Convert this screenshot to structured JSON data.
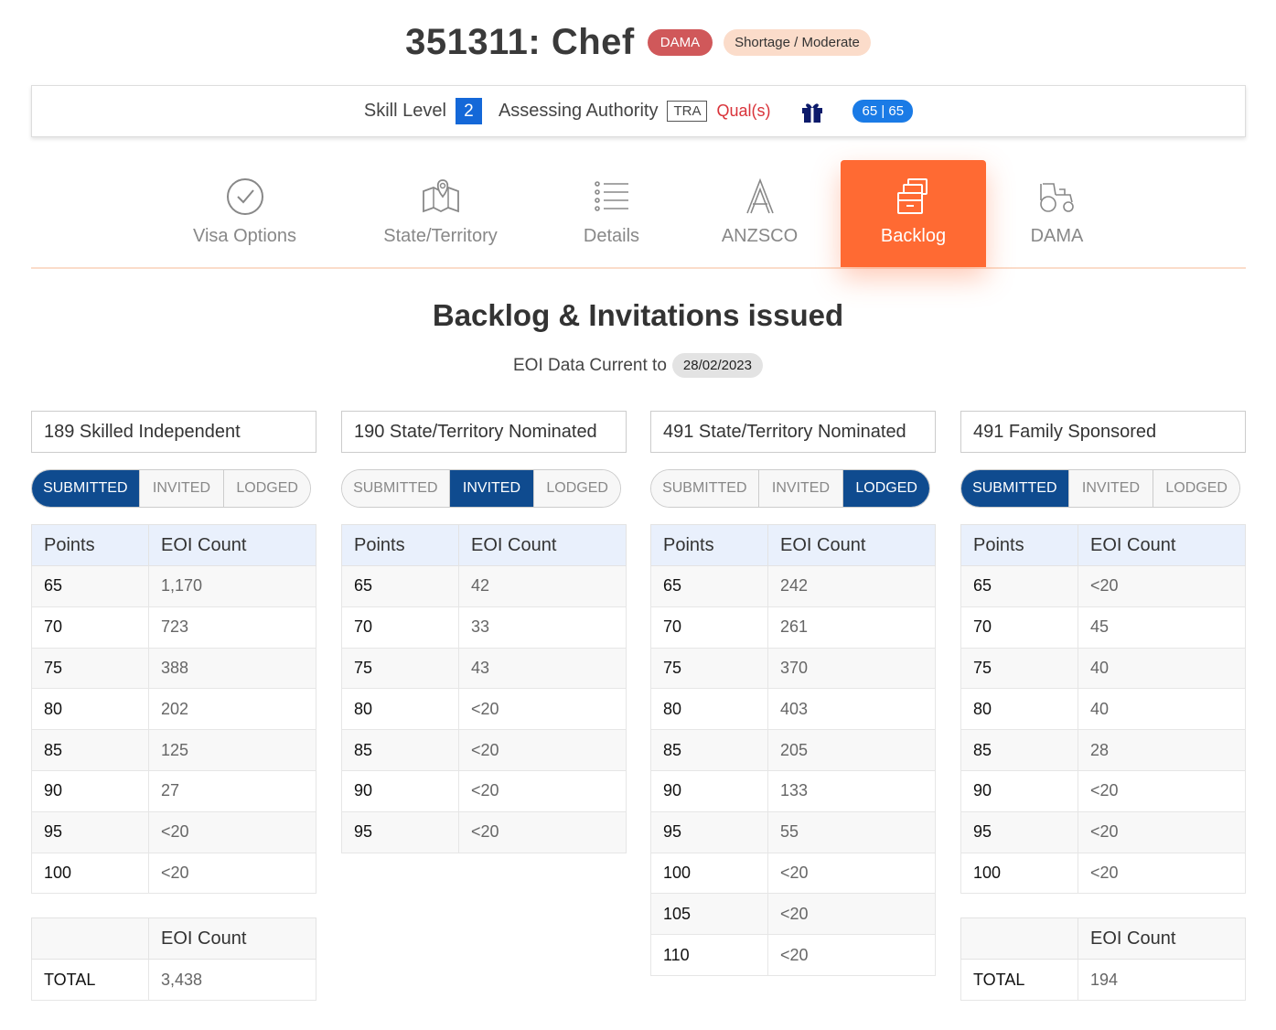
{
  "header": {
    "title": "351311: Chef",
    "badge_dama": "DAMA",
    "badge_shortage": "Shortage / Moderate"
  },
  "info_bar": {
    "skill_level_label": "Skill Level",
    "skill_level_value": "2",
    "assessing_authority_label": "Assessing Authority",
    "assessing_authority_value": "TRA",
    "qual_link": "Qual(s)",
    "points_badge": "65 | 65"
  },
  "tabs": [
    {
      "label": "Visa Options",
      "icon": "check-circle-icon",
      "active": false
    },
    {
      "label": "State/Territory",
      "icon": "map-pin-icon",
      "active": false
    },
    {
      "label": "Details",
      "icon": "list-icon",
      "active": false
    },
    {
      "label": "ANZSCO",
      "icon": "anzsco-a-icon",
      "active": false
    },
    {
      "label": "Backlog",
      "icon": "backlog-stack-icon",
      "active": true
    },
    {
      "label": "DAMA",
      "icon": "tractor-icon",
      "active": false
    }
  ],
  "section": {
    "title": "Backlog & Invitations issued",
    "eoi_label": "EOI Data Current to",
    "eoi_date": "28/02/2023"
  },
  "colors": {
    "accent": "#ff6a33",
    "toggle_active": "#0f4b8f",
    "dama": "#d0585a",
    "shortage": "#fbdcca",
    "skill": "#1468d8"
  },
  "toggle_labels": [
    "SUBMITTED",
    "INVITED",
    "LODGED"
  ],
  "table_headers": {
    "points": "Points",
    "count": "EOI Count"
  },
  "total_label": "TOTAL",
  "columns": [
    {
      "title": "189 Skilled Independent",
      "active_toggle": 0,
      "rows": [
        {
          "points": "65",
          "count": "1,170"
        },
        {
          "points": "70",
          "count": "723"
        },
        {
          "points": "75",
          "count": "388"
        },
        {
          "points": "80",
          "count": "202"
        },
        {
          "points": "85",
          "count": "125"
        },
        {
          "points": "90",
          "count": "27"
        },
        {
          "points": "95",
          "count": "<20"
        },
        {
          "points": "100",
          "count": "<20"
        }
      ],
      "total": "3,438"
    },
    {
      "title": "190 State/Territory Nominated",
      "active_toggle": 1,
      "rows": [
        {
          "points": "65",
          "count": "42"
        },
        {
          "points": "70",
          "count": "33"
        },
        {
          "points": "75",
          "count": "43"
        },
        {
          "points": "80",
          "count": "<20"
        },
        {
          "points": "85",
          "count": "<20"
        },
        {
          "points": "90",
          "count": "<20"
        },
        {
          "points": "95",
          "count": "<20"
        }
      ]
    },
    {
      "title": "491 State/Territory Nominated",
      "active_toggle": 2,
      "rows": [
        {
          "points": "65",
          "count": "242"
        },
        {
          "points": "70",
          "count": "261"
        },
        {
          "points": "75",
          "count": "370"
        },
        {
          "points": "80",
          "count": "403"
        },
        {
          "points": "85",
          "count": "205"
        },
        {
          "points": "90",
          "count": "133"
        },
        {
          "points": "95",
          "count": "55"
        },
        {
          "points": "100",
          "count": "<20"
        },
        {
          "points": "105",
          "count": "<20"
        },
        {
          "points": "110",
          "count": "<20"
        }
      ]
    },
    {
      "title": "491 Family Sponsored",
      "active_toggle": 0,
      "rows": [
        {
          "points": "65",
          "count": "<20"
        },
        {
          "points": "70",
          "count": "45"
        },
        {
          "points": "75",
          "count": "40"
        },
        {
          "points": "80",
          "count": "40"
        },
        {
          "points": "85",
          "count": "28"
        },
        {
          "points": "90",
          "count": "<20"
        },
        {
          "points": "95",
          "count": "<20"
        },
        {
          "points": "100",
          "count": "<20"
        }
      ],
      "total": "194"
    }
  ]
}
